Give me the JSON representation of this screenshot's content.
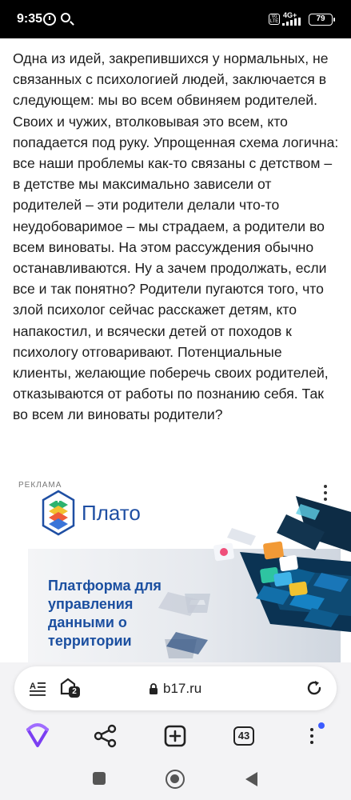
{
  "status_bar": {
    "time": "9:35",
    "volte_label": "Vo LTE",
    "network": "4G+",
    "battery": "79",
    "icons": [
      "alarm-icon",
      "search-icon",
      "signal-icon",
      "battery-icon"
    ]
  },
  "article": {
    "text": "Одна из идей, закрепившихся у нормальных, не связанных с психологией людей, заключается в следующем: мы во всем обвиняем родителей. Своих и чужих, втолковывая это всем, кто попадается под руку. Упрощенная схема логична: все наши проблемы как-то связаны с детством – в детстве мы максимально зависели от родителей – эти родители делали что-то неудобоваримое – мы страдаем, а родители во всем виноваты. На этом рассуждения обычно останавливаются. Ну а зачем продолжать, если все и так понятно? Родители пугаются того, что злой психолог сейчас расскажет детям, кто напакостил, и всячески детей от походов к психологу отговаривают. Потенциальные клиенты, желающие поберечь своих родителей, отказываются от работы по познанию себя. Так во всем ли виноваты родители?"
  },
  "ad": {
    "label": "РЕКЛАМА",
    "brand": "Плато",
    "headline": "Платформа для управления данными о территории"
  },
  "address_bar": {
    "url": "b17.ru",
    "tabs_badge": "2"
  },
  "toolbar": {
    "tab_count": "43"
  },
  "colors": {
    "brand_blue": "#1b4fa0",
    "alice_purple": "#7b3ff2",
    "menu_badge": "#3b5bff"
  }
}
